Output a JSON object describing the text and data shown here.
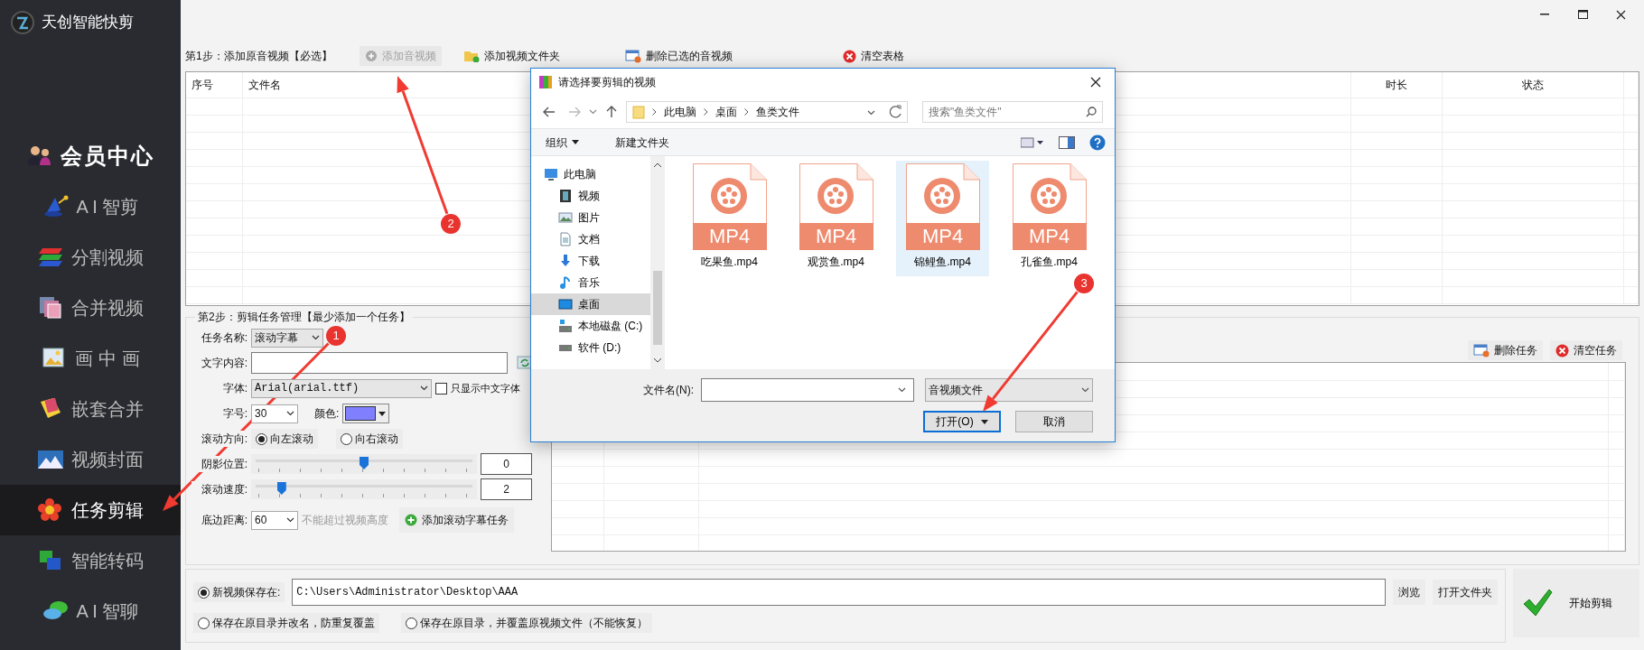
{
  "app": {
    "title": "天创智能快剪"
  },
  "sidebar": {
    "items": [
      {
        "label": "会员中心",
        "kind": "header",
        "selected": false
      },
      {
        "label": "A I 智剪",
        "kind": "item",
        "selected": false
      },
      {
        "label": "分割视频",
        "kind": "item",
        "selected": false
      },
      {
        "label": "合并视频",
        "kind": "item",
        "selected": false
      },
      {
        "label": "画 中 画",
        "kind": "item",
        "selected": false
      },
      {
        "label": "嵌套合并",
        "kind": "item",
        "selected": false
      },
      {
        "label": "视频封面",
        "kind": "item",
        "selected": false
      },
      {
        "label": "任务剪辑",
        "kind": "item",
        "selected": true
      },
      {
        "label": "智能转码",
        "kind": "item",
        "selected": false
      },
      {
        "label": "A I 智聊",
        "kind": "item",
        "selected": false
      }
    ]
  },
  "step1": {
    "title": "第1步：添加原音视频【必选】",
    "buttons": [
      {
        "label": "添加音视频",
        "disabled": true
      },
      {
        "label": "添加视频文件夹",
        "disabled": false
      },
      {
        "label": "删除已选的音视频",
        "disabled": false
      },
      {
        "label": "清空表格",
        "disabled": false
      }
    ]
  },
  "file_table": {
    "columns": [
      "序号",
      "文件名",
      "时长",
      "状态"
    ]
  },
  "step2": {
    "title": "第2步：剪辑任务管理【最少添加一个任务】",
    "task_name": {
      "label": "任务名称:",
      "value": "滚动字幕"
    },
    "text_content": {
      "label": "文字内容:"
    },
    "font": {
      "label": "字体:",
      "value": "Arial(arial.ttf)"
    },
    "chinese_only": {
      "label": "只显示中文字体",
      "checked": false
    },
    "font_size": {
      "label": "字号:",
      "value": "30"
    },
    "color": {
      "label": "颜色:",
      "color": "#8080ff"
    },
    "direction": {
      "label": "滚动方向:",
      "options": [
        {
          "label": "向左滚动",
          "selected": true
        },
        {
          "label": "向右滚动",
          "selected": false
        }
      ]
    },
    "sliders": [
      {
        "label": "阴影位置:",
        "level": 0.5,
        "value": "0"
      },
      {
        "label": "滚动速度:",
        "level": 0.12,
        "value": "2"
      }
    ],
    "bottom_margin": {
      "label": "底边距离:",
      "value": "60",
      "hint": "不能超过视频高度"
    },
    "add_button": "添加滚动字幕任务",
    "task_buttons": [
      "删除任务",
      "清空任务"
    ]
  },
  "output": {
    "options": [
      {
        "label": "新视频保存在:",
        "selected": true
      },
      {
        "label": "保存在原目录并改名，防重复覆盖",
        "selected": false
      },
      {
        "label": "保存在原目录，并覆盖原视频文件（不能恢复）",
        "selected": false
      }
    ],
    "path": "C:\\Users\\Administrator\\Desktop\\AAA",
    "buttons": [
      "浏览",
      "打开文件夹"
    ]
  },
  "start_button": "开始剪辑",
  "dialog": {
    "title": "请选择要剪辑的视频",
    "breadcrumb": [
      "此电脑",
      "桌面",
      "鱼类文件"
    ],
    "search_placeholder": "搜索\"鱼类文件\"",
    "toolbar": [
      "组织",
      "新建文件夹"
    ],
    "nav": [
      {
        "label": "此电脑",
        "selected": false,
        "children": [
          {
            "label": "视频",
            "selected": false
          },
          {
            "label": "图片",
            "selected": false
          },
          {
            "label": "文档",
            "selected": false
          },
          {
            "label": "下载",
            "selected": false
          },
          {
            "label": "音乐",
            "selected": false
          },
          {
            "label": "桌面",
            "selected": true
          },
          {
            "label": "本地磁盘 (C:)",
            "selected": false
          },
          {
            "label": "软件 (D:)",
            "selected": false
          }
        ]
      }
    ],
    "files": [
      {
        "name": "吃果鱼.mp4",
        "type_label": "MP4",
        "selected": false
      },
      {
        "name": "观赏鱼.mp4",
        "type_label": "MP4",
        "selected": false
      },
      {
        "name": "锦鲤鱼.mp4",
        "type_label": "MP4",
        "selected": true
      },
      {
        "name": "孔雀鱼.mp4",
        "type_label": "MP4",
        "selected": false
      }
    ],
    "filename_label": "文件名(N):",
    "filter": "音视频文件",
    "buttons": [
      {
        "label": "打开(O)",
        "kind": "primary"
      },
      {
        "label": "取消",
        "kind": "secondary"
      }
    ]
  },
  "annotations": [
    {
      "number": "1"
    },
    {
      "number": "2"
    },
    {
      "number": "3"
    }
  ]
}
